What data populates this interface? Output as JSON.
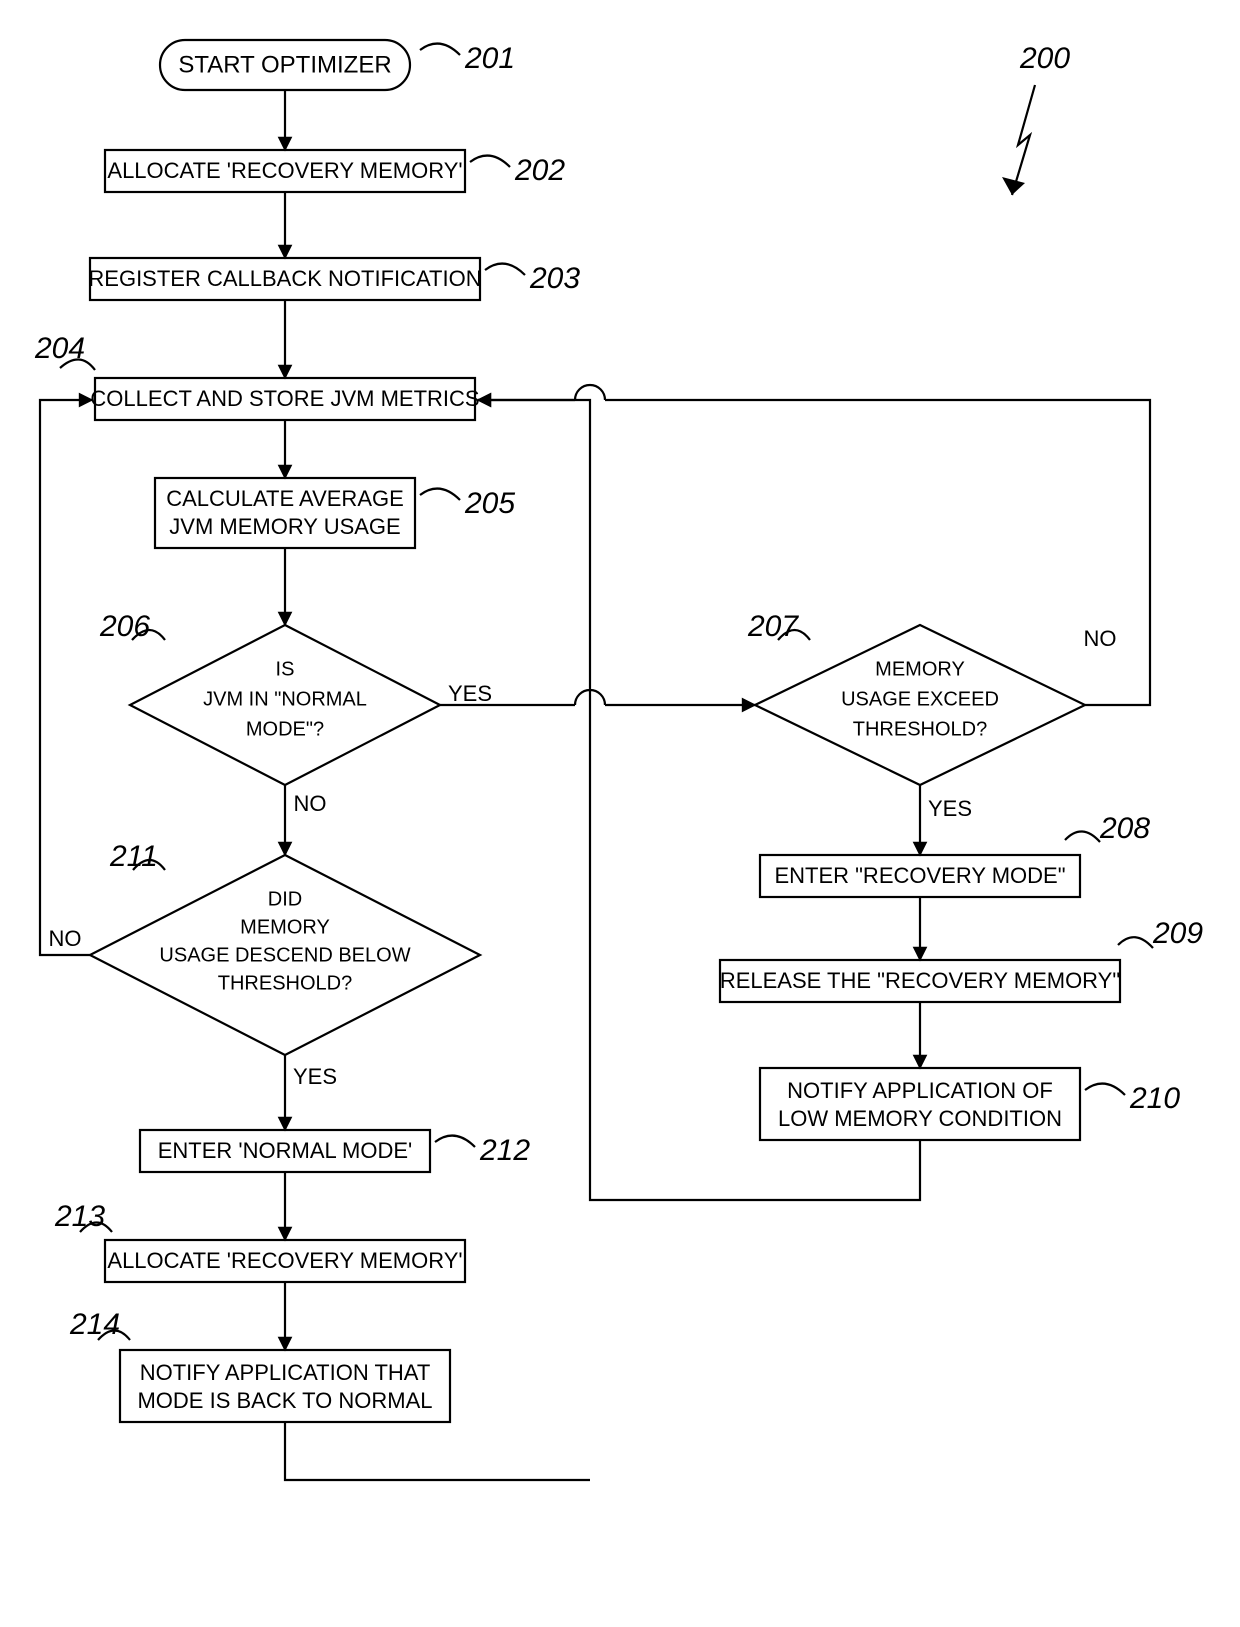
{
  "figure_ref": "200",
  "nodes": {
    "201": {
      "text": "START OPTIMIZER",
      "label": "201"
    },
    "202": {
      "text": "ALLOCATE 'RECOVERY MEMORY'",
      "label": "202"
    },
    "203": {
      "text": "REGISTER CALLBACK NOTIFICATION",
      "label": "203"
    },
    "204": {
      "text": "COLLECT AND STORE JVM METRICS",
      "label": "204"
    },
    "205": {
      "line1": "CALCULATE AVERAGE",
      "line2": "JVM MEMORY USAGE",
      "label": "205"
    },
    "206": {
      "line1": "IS",
      "line2": "JVM IN \"NORMAL",
      "line3": "MODE\"?",
      "label": "206"
    },
    "207": {
      "line1": "MEMORY",
      "line2": "USAGE EXCEED",
      "line3": "THRESHOLD?",
      "label": "207"
    },
    "208": {
      "text": "ENTER \"RECOVERY MODE\"",
      "label": "208"
    },
    "209": {
      "text": "RELEASE THE \"RECOVERY MEMORY\"",
      "label": "209"
    },
    "210": {
      "line1": "NOTIFY APPLICATION OF",
      "line2": "LOW MEMORY CONDITION",
      "label": "210"
    },
    "211": {
      "line1": "DID",
      "line2": "MEMORY",
      "line3": "USAGE DESCEND BELOW",
      "line4": "THRESHOLD?",
      "label": "211"
    },
    "212": {
      "text": "ENTER 'NORMAL MODE'",
      "label": "212"
    },
    "213": {
      "text": "ALLOCATE 'RECOVERY MEMORY'",
      "label": "213"
    },
    "214": {
      "line1": "NOTIFY APPLICATION THAT",
      "line2": "MODE IS BACK TO NORMAL",
      "label": "214"
    }
  },
  "edges": {
    "yes": "YES",
    "no": "NO"
  }
}
